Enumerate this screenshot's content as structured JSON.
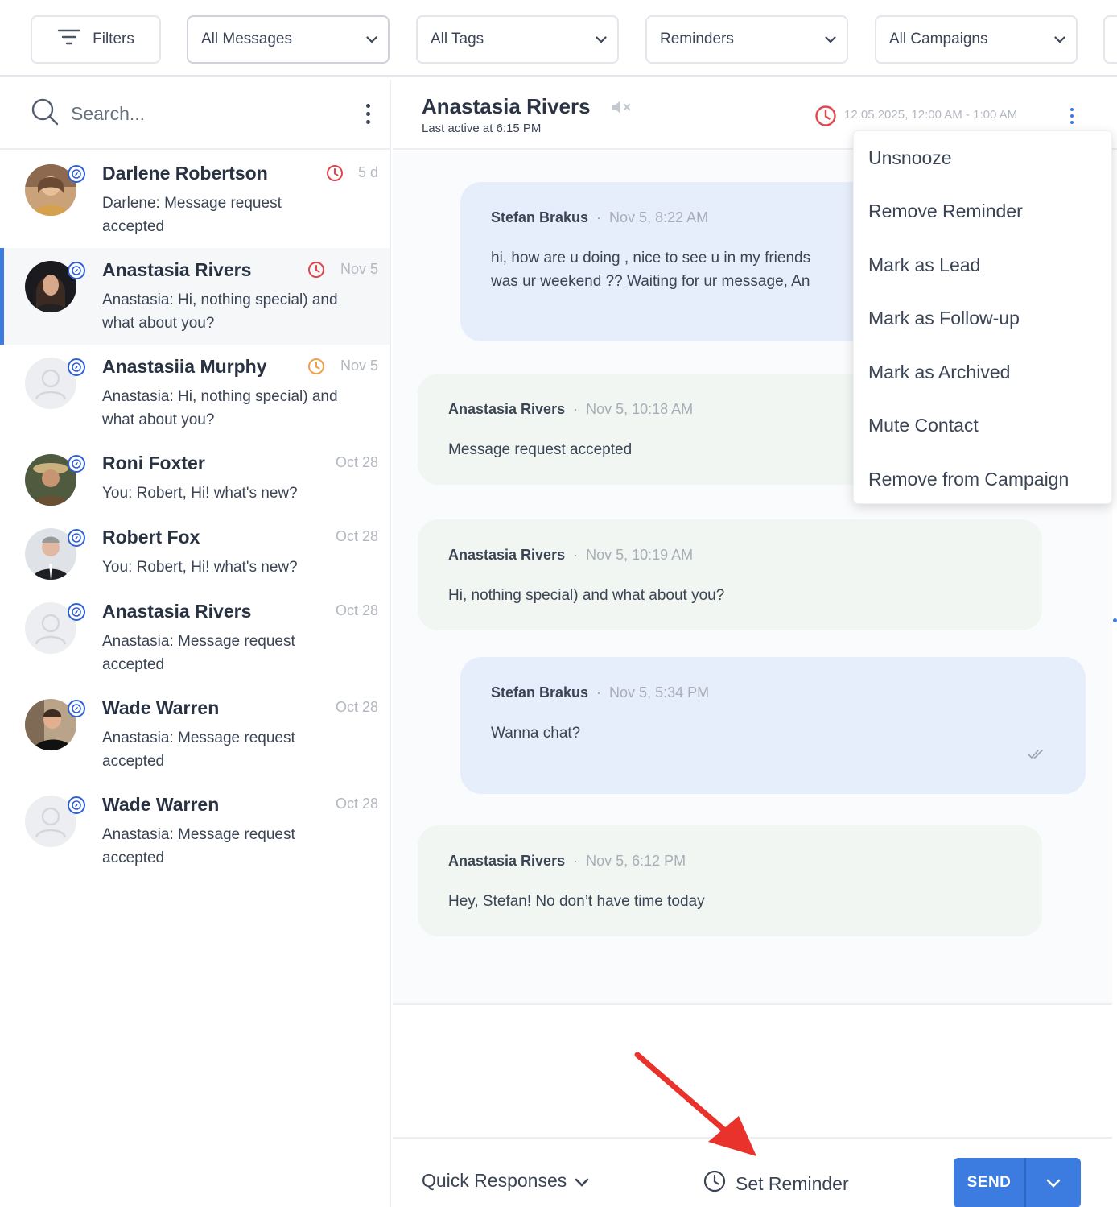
{
  "filters": {
    "filters_label": "Filters",
    "messages": "All Messages",
    "tags": "All Tags",
    "reminders": "Reminders",
    "campaigns": "All Campaigns"
  },
  "sidebar": {
    "search_placeholder": "Search...",
    "conversations": [
      {
        "name": "Darlene Robertson",
        "time": "5 d",
        "preview": "Darlene: Message request accepted",
        "reminder": "red"
      },
      {
        "name": "Anastasia Rivers",
        "time": "Nov 5",
        "preview": "Anastasia: Hi, nothing special) and what about you?",
        "reminder": "red",
        "active": true
      },
      {
        "name": "Anastasiia Murphy",
        "time": "Nov 5",
        "preview": "Anastasia: Hi, nothing special) and what about you?",
        "reminder": "orange"
      },
      {
        "name": "Roni Foxter",
        "time": "Oct 28",
        "preview": "You: Robert, Hi! what's new?"
      },
      {
        "name": "Robert Fox",
        "time": "Oct 28",
        "preview": "You: Robert, Hi! what's new?"
      },
      {
        "name": "Anastasia Rivers",
        "time": "Oct 28",
        "preview": "Anastasia: Message request accepted"
      },
      {
        "name": "Wade Warren",
        "time": "Oct 28",
        "preview": "Anastasia: Message request accepted"
      },
      {
        "name": "Wade Warren",
        "time": "Oct 28",
        "preview": "Anastasia: Message request accepted"
      }
    ]
  },
  "chat": {
    "contact_name": "Anastasia Rivers",
    "last_active": "Last active at 6:15 PM",
    "reminder_time": "12.05.2025, 12:00 AM - 1:00 AM",
    "messages": [
      {
        "from": "Stefan Brakus",
        "time": "Nov 5, 8:22 AM",
        "line1": "hi, how are u doing , nice to see u in my friends",
        "line2": "was ur weekend ?? Waiting for ur message, An"
      },
      {
        "from": "Anastasia Rivers",
        "time": "Nov 5, 10:18 AM",
        "text": "Message request accepted"
      },
      {
        "from": "Anastasia Rivers",
        "time": "Nov 5, 10:19 AM",
        "text": "Hi, nothing special) and what about you?"
      },
      {
        "from": "Stefan Brakus",
        "time": "Nov 5, 5:34 PM",
        "text": "Wanna chat?"
      },
      {
        "from": "Anastasia Rivers",
        "time": "Nov 5, 6:12 PM",
        "text": "Hey, Stefan! No don’t have time today"
      }
    ],
    "separator": "·"
  },
  "menu": {
    "items": [
      "Unsnooze",
      "Remove Reminder",
      "Mark as Lead",
      "Mark as Follow-up",
      "Mark as Archived",
      "Mute Contact",
      "Remove from Campaign"
    ]
  },
  "composer": {
    "quick_responses": "Quick Responses",
    "set_reminder": "Set Reminder",
    "send": "SEND"
  },
  "colors": {
    "accent": "#3c7be0",
    "reminder_red": "#e0474c",
    "reminder_orange": "#f0a04b",
    "annotation_arrow": "#e8322b"
  }
}
